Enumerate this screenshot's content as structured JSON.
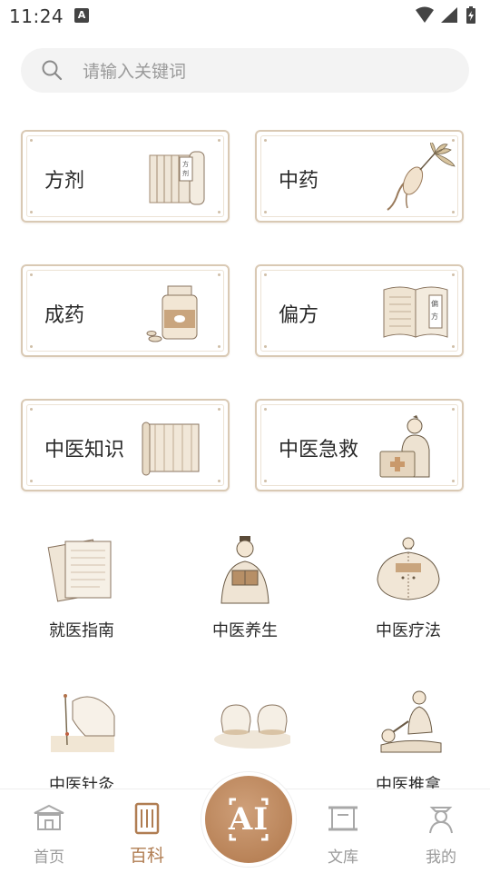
{
  "status_bar": {
    "time": "11:24",
    "notification_badge": "A"
  },
  "search": {
    "placeholder": "请输入关键词"
  },
  "categories": [
    {
      "label": "方剂",
      "icon": "scroll-book-icon"
    },
    {
      "label": "中药",
      "icon": "ginseng-icon"
    },
    {
      "label": "成药",
      "icon": "medicine-bottle-icon"
    },
    {
      "label": "偏方",
      "icon": "open-book-icon"
    },
    {
      "label": "中医知识",
      "icon": "bamboo-scroll-icon"
    },
    {
      "label": "中医急救",
      "icon": "first-aid-doctor-icon"
    }
  ],
  "grid": [
    {
      "label": "就医指南",
      "icon": "paper-sheets-icon"
    },
    {
      "label": "中医养生",
      "icon": "scholar-reading-icon"
    },
    {
      "label": "中医疗法",
      "icon": "back-acupoint-icon"
    },
    {
      "label": "中医针灸",
      "icon": "acupuncture-hand-icon"
    },
    {
      "label": "",
      "icon": "cupping-icon"
    },
    {
      "label": "中医推拿",
      "icon": "massage-icon"
    }
  ],
  "bottom_nav": {
    "home": "首页",
    "encyclopedia": "百科",
    "ai": "AI",
    "library": "文库",
    "mine": "我的"
  },
  "colors": {
    "accent": "#b07d52",
    "card_border": "#d9c9b4",
    "muted": "#9a9a9a"
  }
}
